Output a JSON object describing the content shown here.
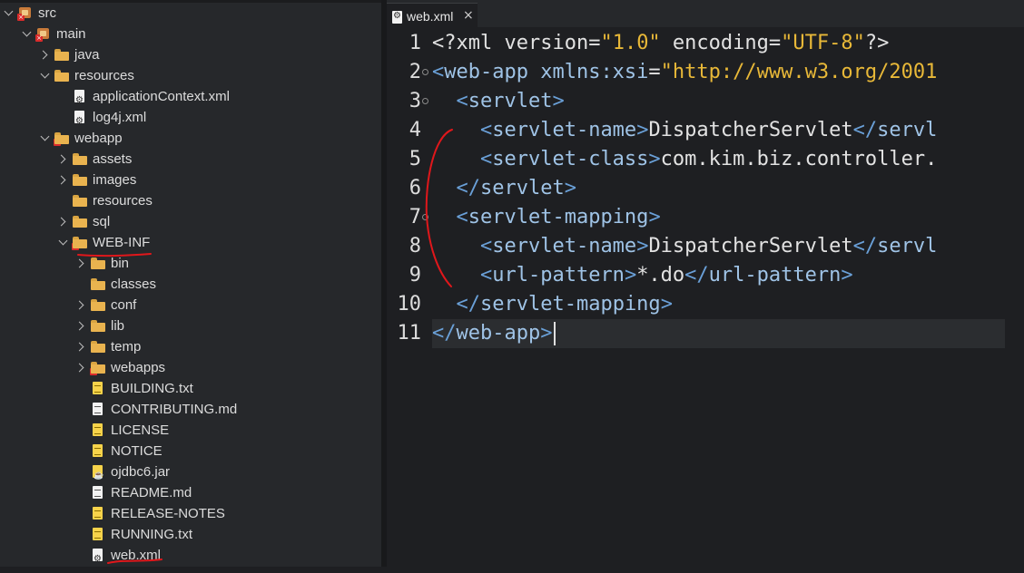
{
  "explorer": {
    "items": [
      {
        "label": "src",
        "icon": "package-error-icon"
      },
      {
        "label": "main",
        "icon": "package-error-icon"
      },
      {
        "label": "java",
        "icon": "folder-icon"
      },
      {
        "label": "resources",
        "icon": "folder-icon"
      },
      {
        "label": "applicationContext.xml",
        "icon": "xml-file-icon"
      },
      {
        "label": "log4j.xml",
        "icon": "xml-file-icon"
      },
      {
        "label": "webapp",
        "icon": "folder-error-icon"
      },
      {
        "label": "assets",
        "icon": "folder-icon"
      },
      {
        "label": "images",
        "icon": "folder-icon"
      },
      {
        "label": "resources",
        "icon": "folder-icon"
      },
      {
        "label": "sql",
        "icon": "folder-icon"
      },
      {
        "label": "WEB-INF",
        "icon": "folder-error-icon"
      },
      {
        "label": "bin",
        "icon": "folder-icon"
      },
      {
        "label": "classes",
        "icon": "folder-icon"
      },
      {
        "label": "conf",
        "icon": "folder-icon"
      },
      {
        "label": "lib",
        "icon": "folder-icon"
      },
      {
        "label": "temp",
        "icon": "folder-icon"
      },
      {
        "label": "webapps",
        "icon": "folder-error-icon"
      },
      {
        "label": "BUILDING.txt",
        "icon": "text-file-icon"
      },
      {
        "label": "CONTRIBUTING.md",
        "icon": "markdown-file-icon"
      },
      {
        "label": "LICENSE",
        "icon": "text-file-icon"
      },
      {
        "label": "NOTICE",
        "icon": "text-file-icon"
      },
      {
        "label": "ojdbc6.jar",
        "icon": "jar-file-icon"
      },
      {
        "label": "README.md",
        "icon": "markdown-file-icon"
      },
      {
        "label": "RELEASE-NOTES",
        "icon": "text-file-icon"
      },
      {
        "label": "RUNNING.txt",
        "icon": "text-file-icon"
      },
      {
        "label": "web.xml",
        "icon": "xml-file-icon"
      }
    ]
  },
  "editor": {
    "tab": {
      "label": "web.xml",
      "close": "×"
    },
    "line_numbers": [
      "1",
      "2",
      "3",
      "4",
      "5",
      "6",
      "7",
      "8",
      "9",
      "10",
      "11"
    ],
    "lines": [
      [
        {
          "t": "<?",
          "c": "pi"
        },
        {
          "t": "xml ",
          "c": "pi"
        },
        {
          "t": "version",
          "c": "pi"
        },
        {
          "t": "=",
          "c": "pi"
        },
        {
          "t": "\"1.0\"",
          "c": "str"
        },
        {
          "t": " encoding",
          "c": "pi"
        },
        {
          "t": "=",
          "c": "pi"
        },
        {
          "t": "\"UTF-8\"",
          "c": "str"
        },
        {
          "t": "?>",
          "c": "pi"
        }
      ],
      [
        {
          "t": "<",
          "c": "br"
        },
        {
          "t": "web-app",
          "c": "tag"
        },
        {
          "t": " xmlns:xsi",
          "c": "tag"
        },
        {
          "t": "=",
          "c": "txt"
        },
        {
          "t": "\"http://www.w3.org/2001",
          "c": "str"
        }
      ],
      [
        {
          "t": "  ",
          "c": "txt"
        },
        {
          "t": "<",
          "c": "br"
        },
        {
          "t": "servlet",
          "c": "tag"
        },
        {
          "t": ">",
          "c": "br"
        }
      ],
      [
        {
          "t": "    ",
          "c": "txt"
        },
        {
          "t": "<",
          "c": "br"
        },
        {
          "t": "servlet-name",
          "c": "tag"
        },
        {
          "t": ">",
          "c": "br"
        },
        {
          "t": "DispatcherServlet",
          "c": "txt"
        },
        {
          "t": "</",
          "c": "br"
        },
        {
          "t": "servl",
          "c": "tag"
        }
      ],
      [
        {
          "t": "    ",
          "c": "txt"
        },
        {
          "t": "<",
          "c": "br"
        },
        {
          "t": "servlet-class",
          "c": "tag"
        },
        {
          "t": ">",
          "c": "br"
        },
        {
          "t": "com.kim.biz.controller.",
          "c": "txt"
        }
      ],
      [
        {
          "t": "  ",
          "c": "txt"
        },
        {
          "t": "</",
          "c": "br"
        },
        {
          "t": "servlet",
          "c": "tag"
        },
        {
          "t": ">",
          "c": "br"
        }
      ],
      [
        {
          "t": "  ",
          "c": "txt"
        },
        {
          "t": "<",
          "c": "br"
        },
        {
          "t": "servlet-mapping",
          "c": "tag"
        },
        {
          "t": ">",
          "c": "br"
        }
      ],
      [
        {
          "t": "    ",
          "c": "txt"
        },
        {
          "t": "<",
          "c": "br"
        },
        {
          "t": "servlet-name",
          "c": "tag"
        },
        {
          "t": ">",
          "c": "br"
        },
        {
          "t": "DispatcherServlet",
          "c": "txt"
        },
        {
          "t": "</",
          "c": "br"
        },
        {
          "t": "servl",
          "c": "tag"
        }
      ],
      [
        {
          "t": "    ",
          "c": "txt"
        },
        {
          "t": "<",
          "c": "br"
        },
        {
          "t": "url-pattern",
          "c": "tag"
        },
        {
          "t": ">",
          "c": "br"
        },
        {
          "t": "*.do",
          "c": "txt"
        },
        {
          "t": "</",
          "c": "br"
        },
        {
          "t": "url-pattern",
          "c": "tag"
        },
        {
          "t": ">",
          "c": "br"
        }
      ],
      [
        {
          "t": "  ",
          "c": "txt"
        },
        {
          "t": "</",
          "c": "br"
        },
        {
          "t": "servlet-mapping",
          "c": "tag"
        },
        {
          "t": ">",
          "c": "br"
        }
      ],
      [
        {
          "t": "</",
          "c": "br"
        },
        {
          "t": "web-app",
          "c": "tag"
        },
        {
          "t": ">",
          "c": "br"
        }
      ]
    ],
    "current_line": 11,
    "fold_markers_on_lines": [
      2,
      3,
      7
    ]
  },
  "colors": {
    "annotation": "#e0171b"
  }
}
